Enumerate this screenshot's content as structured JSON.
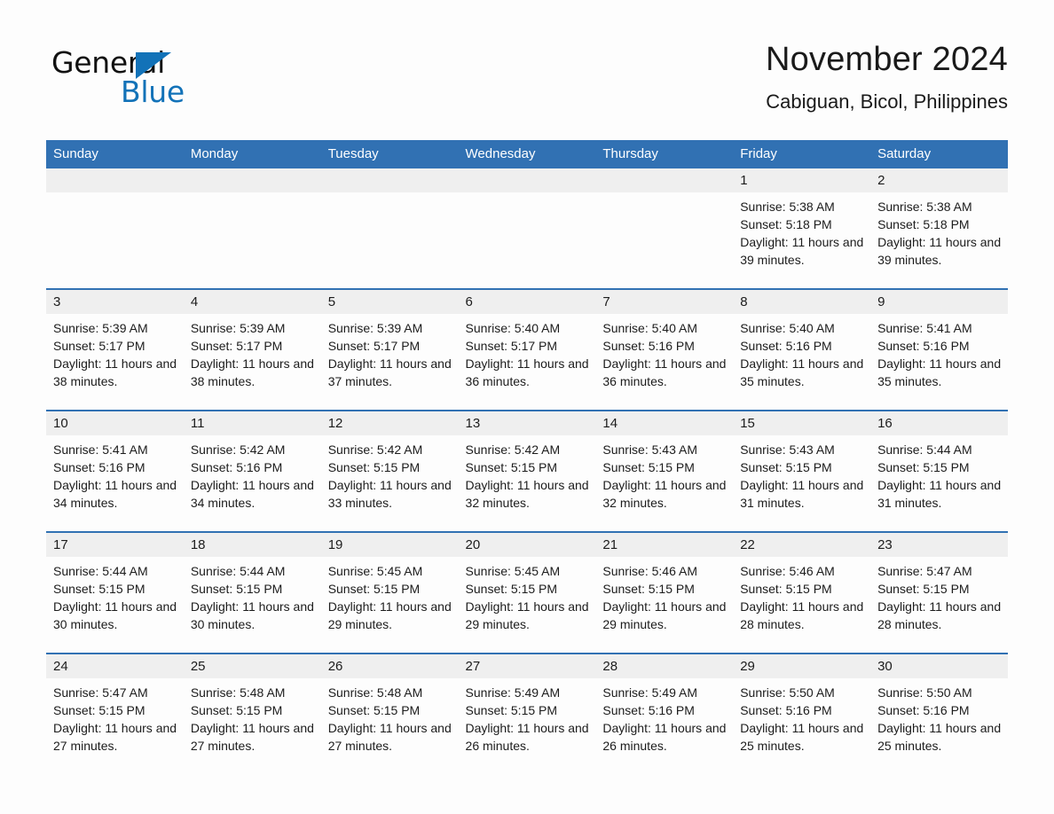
{
  "logo": {
    "word1": "General",
    "word2": "Blue",
    "triangle_color": "#1272b8",
    "icon": "triangle-icon"
  },
  "header": {
    "month_title": "November 2024",
    "location": "Cabiguan, Bicol, Philippines"
  },
  "theme": {
    "header_blue": "#3171b3",
    "daynum_gray": "#efefef",
    "page_bg": "#fdfdfd",
    "text": "#1c1c1c"
  },
  "weekdays": [
    "Sunday",
    "Monday",
    "Tuesday",
    "Wednesday",
    "Thursday",
    "Friday",
    "Saturday"
  ],
  "weeks": [
    [
      {
        "day": "",
        "sunrise": "",
        "sunset": "",
        "daylight": "",
        "empty": true
      },
      {
        "day": "",
        "sunrise": "",
        "sunset": "",
        "daylight": "",
        "empty": true
      },
      {
        "day": "",
        "sunrise": "",
        "sunset": "",
        "daylight": "",
        "empty": true
      },
      {
        "day": "",
        "sunrise": "",
        "sunset": "",
        "daylight": "",
        "empty": true
      },
      {
        "day": "",
        "sunrise": "",
        "sunset": "",
        "daylight": "",
        "empty": true
      },
      {
        "day": "1",
        "sunrise": "Sunrise: 5:38 AM",
        "sunset": "Sunset: 5:18 PM",
        "daylight": "Daylight: 11 hours and 39 minutes.",
        "empty": false
      },
      {
        "day": "2",
        "sunrise": "Sunrise: 5:38 AM",
        "sunset": "Sunset: 5:18 PM",
        "daylight": "Daylight: 11 hours and 39 minutes.",
        "empty": false
      }
    ],
    [
      {
        "day": "3",
        "sunrise": "Sunrise: 5:39 AM",
        "sunset": "Sunset: 5:17 PM",
        "daylight": "Daylight: 11 hours and 38 minutes.",
        "empty": false
      },
      {
        "day": "4",
        "sunrise": "Sunrise: 5:39 AM",
        "sunset": "Sunset: 5:17 PM",
        "daylight": "Daylight: 11 hours and 38 minutes.",
        "empty": false
      },
      {
        "day": "5",
        "sunrise": "Sunrise: 5:39 AM",
        "sunset": "Sunset: 5:17 PM",
        "daylight": "Daylight: 11 hours and 37 minutes.",
        "empty": false
      },
      {
        "day": "6",
        "sunrise": "Sunrise: 5:40 AM",
        "sunset": "Sunset: 5:17 PM",
        "daylight": "Daylight: 11 hours and 36 minutes.",
        "empty": false
      },
      {
        "day": "7",
        "sunrise": "Sunrise: 5:40 AM",
        "sunset": "Sunset: 5:16 PM",
        "daylight": "Daylight: 11 hours and 36 minutes.",
        "empty": false
      },
      {
        "day": "8",
        "sunrise": "Sunrise: 5:40 AM",
        "sunset": "Sunset: 5:16 PM",
        "daylight": "Daylight: 11 hours and 35 minutes.",
        "empty": false
      },
      {
        "day": "9",
        "sunrise": "Sunrise: 5:41 AM",
        "sunset": "Sunset: 5:16 PM",
        "daylight": "Daylight: 11 hours and 35 minutes.",
        "empty": false
      }
    ],
    [
      {
        "day": "10",
        "sunrise": "Sunrise: 5:41 AM",
        "sunset": "Sunset: 5:16 PM",
        "daylight": "Daylight: 11 hours and 34 minutes.",
        "empty": false
      },
      {
        "day": "11",
        "sunrise": "Sunrise: 5:42 AM",
        "sunset": "Sunset: 5:16 PM",
        "daylight": "Daylight: 11 hours and 34 minutes.",
        "empty": false
      },
      {
        "day": "12",
        "sunrise": "Sunrise: 5:42 AM",
        "sunset": "Sunset: 5:15 PM",
        "daylight": "Daylight: 11 hours and 33 minutes.",
        "empty": false
      },
      {
        "day": "13",
        "sunrise": "Sunrise: 5:42 AM",
        "sunset": "Sunset: 5:15 PM",
        "daylight": "Daylight: 11 hours and 32 minutes.",
        "empty": false
      },
      {
        "day": "14",
        "sunrise": "Sunrise: 5:43 AM",
        "sunset": "Sunset: 5:15 PM",
        "daylight": "Daylight: 11 hours and 32 minutes.",
        "empty": false
      },
      {
        "day": "15",
        "sunrise": "Sunrise: 5:43 AM",
        "sunset": "Sunset: 5:15 PM",
        "daylight": "Daylight: 11 hours and 31 minutes.",
        "empty": false
      },
      {
        "day": "16",
        "sunrise": "Sunrise: 5:44 AM",
        "sunset": "Sunset: 5:15 PM",
        "daylight": "Daylight: 11 hours and 31 minutes.",
        "empty": false
      }
    ],
    [
      {
        "day": "17",
        "sunrise": "Sunrise: 5:44 AM",
        "sunset": "Sunset: 5:15 PM",
        "daylight": "Daylight: 11 hours and 30 minutes.",
        "empty": false
      },
      {
        "day": "18",
        "sunrise": "Sunrise: 5:44 AM",
        "sunset": "Sunset: 5:15 PM",
        "daylight": "Daylight: 11 hours and 30 minutes.",
        "empty": false
      },
      {
        "day": "19",
        "sunrise": "Sunrise: 5:45 AM",
        "sunset": "Sunset: 5:15 PM",
        "daylight": "Daylight: 11 hours and 29 minutes.",
        "empty": false
      },
      {
        "day": "20",
        "sunrise": "Sunrise: 5:45 AM",
        "sunset": "Sunset: 5:15 PM",
        "daylight": "Daylight: 11 hours and 29 minutes.",
        "empty": false
      },
      {
        "day": "21",
        "sunrise": "Sunrise: 5:46 AM",
        "sunset": "Sunset: 5:15 PM",
        "daylight": "Daylight: 11 hours and 29 minutes.",
        "empty": false
      },
      {
        "day": "22",
        "sunrise": "Sunrise: 5:46 AM",
        "sunset": "Sunset: 5:15 PM",
        "daylight": "Daylight: 11 hours and 28 minutes.",
        "empty": false
      },
      {
        "day": "23",
        "sunrise": "Sunrise: 5:47 AM",
        "sunset": "Sunset: 5:15 PM",
        "daylight": "Daylight: 11 hours and 28 minutes.",
        "empty": false
      }
    ],
    [
      {
        "day": "24",
        "sunrise": "Sunrise: 5:47 AM",
        "sunset": "Sunset: 5:15 PM",
        "daylight": "Daylight: 11 hours and 27 minutes.",
        "empty": false
      },
      {
        "day": "25",
        "sunrise": "Sunrise: 5:48 AM",
        "sunset": "Sunset: 5:15 PM",
        "daylight": "Daylight: 11 hours and 27 minutes.",
        "empty": false
      },
      {
        "day": "26",
        "sunrise": "Sunrise: 5:48 AM",
        "sunset": "Sunset: 5:15 PM",
        "daylight": "Daylight: 11 hours and 27 minutes.",
        "empty": false
      },
      {
        "day": "27",
        "sunrise": "Sunrise: 5:49 AM",
        "sunset": "Sunset: 5:15 PM",
        "daylight": "Daylight: 11 hours and 26 minutes.",
        "empty": false
      },
      {
        "day": "28",
        "sunrise": "Sunrise: 5:49 AM",
        "sunset": "Sunset: 5:16 PM",
        "daylight": "Daylight: 11 hours and 26 minutes.",
        "empty": false
      },
      {
        "day": "29",
        "sunrise": "Sunrise: 5:50 AM",
        "sunset": "Sunset: 5:16 PM",
        "daylight": "Daylight: 11 hours and 25 minutes.",
        "empty": false
      },
      {
        "day": "30",
        "sunrise": "Sunrise: 5:50 AM",
        "sunset": "Sunset: 5:16 PM",
        "daylight": "Daylight: 11 hours and 25 minutes.",
        "empty": false
      }
    ]
  ]
}
